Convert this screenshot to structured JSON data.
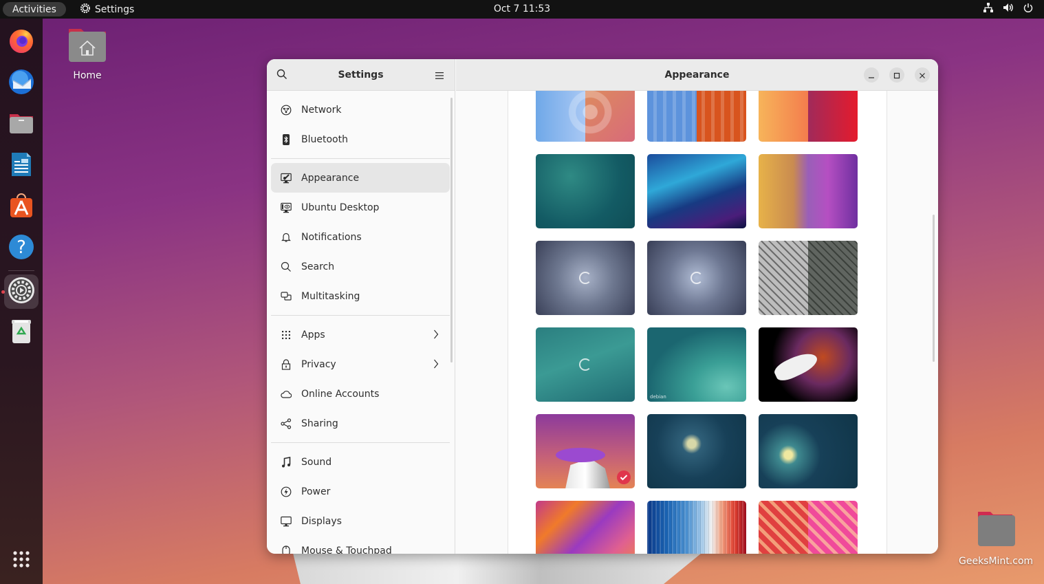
{
  "topbar": {
    "activities_label": "Activities",
    "app_name": "Settings",
    "clock": "Oct 7  11:53",
    "tray_icons": [
      "network-wired-icon",
      "volume-icon",
      "power-icon"
    ]
  },
  "dock": {
    "items": [
      {
        "name": "Firefox",
        "icon": "firefox-icon"
      },
      {
        "name": "Thunderbird",
        "icon": "thunderbird-icon"
      },
      {
        "name": "Files",
        "icon": "files-icon"
      },
      {
        "name": "LibreOffice Writer",
        "icon": "libreoffice-writer-icon"
      },
      {
        "name": "Ubuntu Software",
        "icon": "app-store-icon"
      },
      {
        "name": "Help",
        "icon": "help-icon"
      },
      {
        "name": "Settings",
        "icon": "settings-icon",
        "active": true
      },
      {
        "name": "Trash",
        "icon": "trash-icon"
      }
    ],
    "show_apps_icon": "app-grid-icon"
  },
  "desktop": {
    "icons": [
      {
        "label": "Home",
        "icon": "home-folder-icon"
      },
      {
        "label": "GeeksMint.com",
        "icon": "folder-icon"
      }
    ]
  },
  "window": {
    "sidebar": {
      "title": "Settings",
      "groups": [
        [
          {
            "label": "Network",
            "icon": "network-icon"
          },
          {
            "label": "Bluetooth",
            "icon": "bluetooth-icon"
          }
        ],
        [
          {
            "label": "Appearance",
            "icon": "appearance-icon",
            "selected": true
          },
          {
            "label": "Ubuntu Desktop",
            "icon": "ubuntu-desktop-icon"
          },
          {
            "label": "Notifications",
            "icon": "bell-icon"
          },
          {
            "label": "Search",
            "icon": "search-icon"
          },
          {
            "label": "Multitasking",
            "icon": "multitasking-icon"
          }
        ],
        [
          {
            "label": "Apps",
            "icon": "apps-grid-icon",
            "chevron": true
          },
          {
            "label": "Privacy",
            "icon": "lock-icon",
            "chevron": true
          },
          {
            "label": "Online Accounts",
            "icon": "cloud-icon"
          },
          {
            "label": "Sharing",
            "icon": "share-icon"
          }
        ],
        [
          {
            "label": "Sound",
            "icon": "music-note-icon"
          },
          {
            "label": "Power",
            "icon": "power-bolt-icon"
          },
          {
            "label": "Displays",
            "icon": "monitor-icon"
          },
          {
            "label": "Mouse & Touchpad",
            "icon": "mouse-icon"
          }
        ]
      ]
    },
    "main": {
      "title": "Appearance",
      "controls": [
        "minimize",
        "maximize",
        "close"
      ],
      "wallpapers": [
        {
          "name": "wallpaper-1",
          "style": "w1"
        },
        {
          "name": "wallpaper-2",
          "style": "w2"
        },
        {
          "name": "wallpaper-3",
          "style": "w3"
        },
        {
          "name": "wallpaper-4",
          "style": "w4"
        },
        {
          "name": "wallpaper-5",
          "style": "w5"
        },
        {
          "name": "wallpaper-6",
          "style": "w6"
        },
        {
          "name": "wallpaper-7",
          "style": "w7",
          "swirl": true
        },
        {
          "name": "wallpaper-8",
          "style": "w8",
          "swirl": true
        },
        {
          "name": "wallpaper-9",
          "style": "w9"
        },
        {
          "name": "wallpaper-10",
          "style": "w10",
          "swirl": true
        },
        {
          "name": "wallpaper-11",
          "style": "w11",
          "caption": "debian"
        },
        {
          "name": "wallpaper-12",
          "style": "w12"
        },
        {
          "name": "wallpaper-13",
          "style": "w13",
          "selected": true
        },
        {
          "name": "wallpaper-14",
          "style": "w14"
        },
        {
          "name": "wallpaper-15",
          "style": "w15"
        },
        {
          "name": "wallpaper-16",
          "style": "w16"
        },
        {
          "name": "wallpaper-17",
          "style": "w17"
        },
        {
          "name": "wallpaper-18",
          "style": "w18"
        }
      ]
    }
  }
}
